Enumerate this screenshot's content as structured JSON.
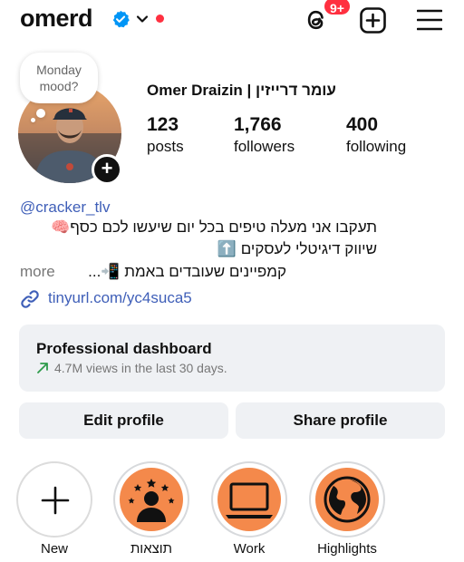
{
  "header": {
    "username": "omerd",
    "notification_count": "9+",
    "icons": [
      "verified-badge-icon",
      "chevron-down-icon",
      "threads-icon",
      "create-post-icon",
      "menu-icon"
    ]
  },
  "note": {
    "text_line1": "Monday",
    "text_line2": "mood?"
  },
  "profile": {
    "full_name": "Omer Draizin | עומר דרייזין",
    "stats": {
      "posts": {
        "value": "123",
        "label": "posts"
      },
      "followers": {
        "value": "1,766",
        "label": "followers"
      },
      "following": {
        "value": "400",
        "label": "following"
      }
    }
  },
  "bio": {
    "handle": "@cracker_tlv",
    "line1": "תעקבו אני מעלה טיפים בכל יום שיעשו לכם כסף🧠",
    "line2": "שיווק דיגיטלי לעסקים ⬆️",
    "line3": "קמפיינים שעובדים באמת 📲...",
    "more_label": "more",
    "link": "tinyurl.com/yc4suca5"
  },
  "dashboard": {
    "title": "Professional dashboard",
    "subtitle": "4.7M views in the last 30 days."
  },
  "buttons": {
    "edit": "Edit profile",
    "share": "Share profile"
  },
  "highlights": [
    {
      "label": "New"
    },
    {
      "label": "תוצאות"
    },
    {
      "label": "Work"
    },
    {
      "label": "Highlights"
    }
  ],
  "colors": {
    "link_blue": "#3f5fb8",
    "badge_red": "#ff3040",
    "highlight_orange": "#f4894b",
    "button_bg": "#eff1f4"
  }
}
